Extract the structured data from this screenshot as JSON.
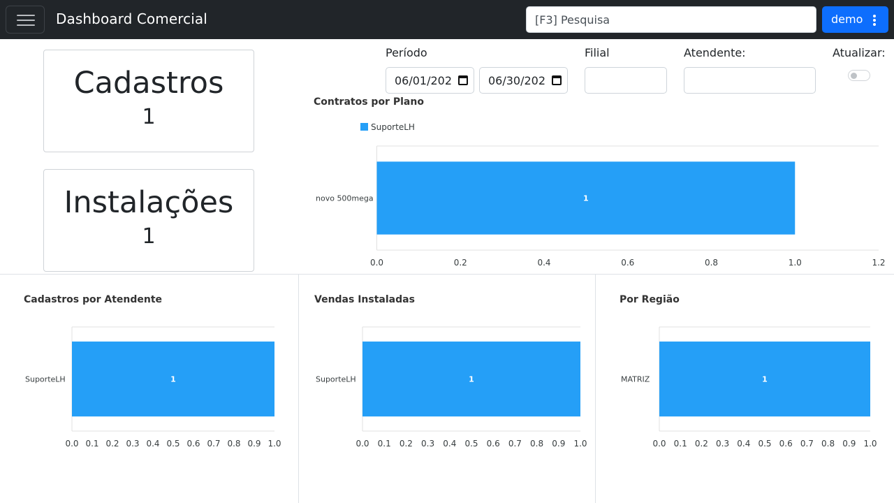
{
  "header": {
    "title": "Dashboard Comercial",
    "search_placeholder": "[F3] Pesquisa",
    "user_label": "demo",
    "icons": [
      "menu-icon",
      "more-vertical-icon"
    ]
  },
  "cards": [
    {
      "title": "Cadastros",
      "value": "1"
    },
    {
      "title": "Instalações",
      "value": "1"
    }
  ],
  "filters": {
    "period_label": "Período",
    "date_from": "06/01/202",
    "date_to": "06/30/202",
    "filial_label": "Filial",
    "atendente_label": "Atendente:",
    "refresh_label": "Atualizar:",
    "refresh_on": false
  },
  "colors": {
    "bar": "#259ff7",
    "navbar": "#212529",
    "primary": "#0d6efd"
  },
  "chart_data": [
    {
      "type": "bar",
      "orientation": "horizontal",
      "title": "Contratos por Plano",
      "legend": [
        "SuporteLH"
      ],
      "legend_position": "top-left",
      "categories": [
        "novo 500mega"
      ],
      "series": [
        {
          "name": "SuporteLH",
          "values": [
            1
          ]
        }
      ],
      "data_labels": [
        "1"
      ],
      "xlim": [
        0,
        1.2
      ],
      "ticks": [
        "0.0",
        "0.2",
        "0.4",
        "0.6",
        "0.8",
        "1.0",
        "1.2"
      ],
      "grid": false
    },
    {
      "type": "bar",
      "orientation": "horizontal",
      "title": "Cadastros por Atendente",
      "categories": [
        "SuporteLH"
      ],
      "values": [
        1
      ],
      "data_labels": [
        "1"
      ],
      "xlim": [
        0,
        1.0
      ],
      "ticks": [
        "0.0",
        "0.1",
        "0.2",
        "0.3",
        "0.4",
        "0.5",
        "0.6",
        "0.7",
        "0.8",
        "0.9",
        "1.0"
      ],
      "grid": false
    },
    {
      "type": "bar",
      "orientation": "horizontal",
      "title": "Vendas Instaladas",
      "categories": [
        "SuporteLH"
      ],
      "values": [
        1
      ],
      "data_labels": [
        "1"
      ],
      "xlim": [
        0,
        1.0
      ],
      "ticks": [
        "0.0",
        "0.1",
        "0.2",
        "0.3",
        "0.4",
        "0.5",
        "0.6",
        "0.7",
        "0.8",
        "0.9",
        "1.0"
      ],
      "grid": false
    },
    {
      "type": "bar",
      "orientation": "horizontal",
      "title": "Por Região",
      "categories": [
        "MATRIZ"
      ],
      "values": [
        1
      ],
      "data_labels": [
        "1"
      ],
      "xlim": [
        0,
        1.0
      ],
      "ticks": [
        "0.0",
        "0.1",
        "0.2",
        "0.3",
        "0.4",
        "0.5",
        "0.6",
        "0.7",
        "0.8",
        "0.9",
        "1.0"
      ],
      "grid": false
    }
  ]
}
